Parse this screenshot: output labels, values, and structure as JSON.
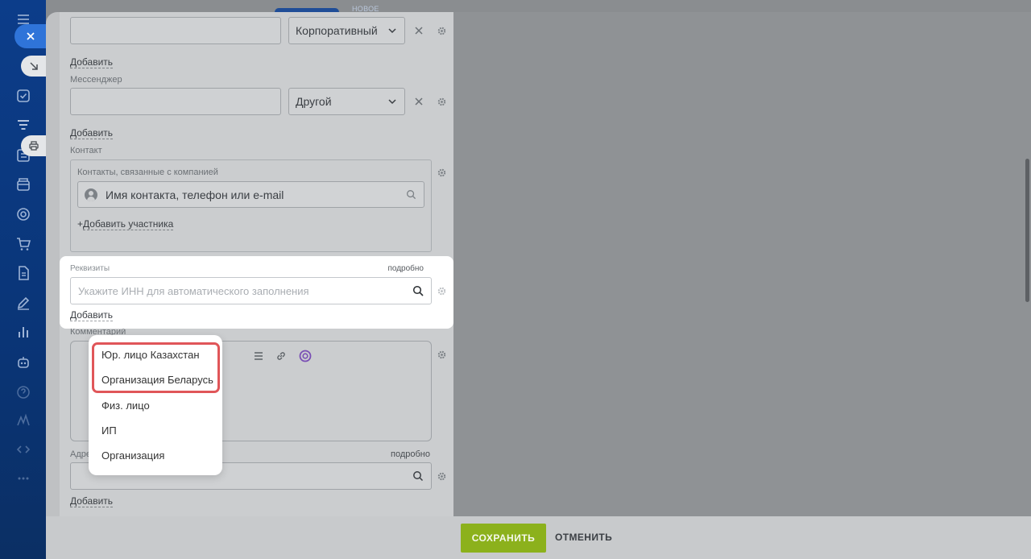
{
  "phone_section": {
    "type_value": "Корпоративный",
    "add_label": "Добавить"
  },
  "messenger_section": {
    "label": "Мессенджер",
    "type_value": "Другой",
    "add_label": "Добавить"
  },
  "contact_section": {
    "label": "Контакт",
    "sublabel": "Контакты, связанные с компанией",
    "input_value": "Имя контакта, телефон или e-mail",
    "add_participant_prefix": "+",
    "add_participant_label": "Добавить участника"
  },
  "requisites_section": {
    "label": "Реквизиты",
    "more_label": "подробно",
    "input_placeholder": "Укажите ИНН для автоматического заполнения",
    "add_label": "Добавить"
  },
  "comment_section": {
    "label": "Комментарий"
  },
  "address_section": {
    "label": "Адре",
    "more_label": "подробно",
    "add_label": "Добавить"
  },
  "header": {
    "new_badge": "НОВОЕ"
  },
  "dropdown": {
    "items": [
      {
        "label": "Юр. лицо Казахстан"
      },
      {
        "label": "Организация Беларусь"
      },
      {
        "label": "Физ. лицо"
      },
      {
        "label": "ИП"
      },
      {
        "label": "Организация"
      }
    ]
  },
  "footer": {
    "save_label": "СОХРАНИТЬ",
    "cancel_label": "ОТМЕНИТЬ"
  },
  "colors": {
    "accent_save": "#8cb11c",
    "highlight_border": "#e05659",
    "sidebar_bg": "#0c3d8a",
    "close_button": "#2f74d9"
  },
  "icons": [
    "menu-icon",
    "close-icon",
    "arrow-down-right-icon",
    "tasks-icon",
    "filter-icon",
    "printer-icon",
    "contacts-icon",
    "store-icon",
    "target-icon",
    "cart-icon",
    "document-icon",
    "edit-icon",
    "analytics-icon",
    "robot-icon",
    "help-icon",
    "marketing-icon",
    "code-icon",
    "more-icon",
    "gear-icon",
    "search-icon",
    "chevron-down-icon",
    "link-icon",
    "copilot-icon"
  ]
}
